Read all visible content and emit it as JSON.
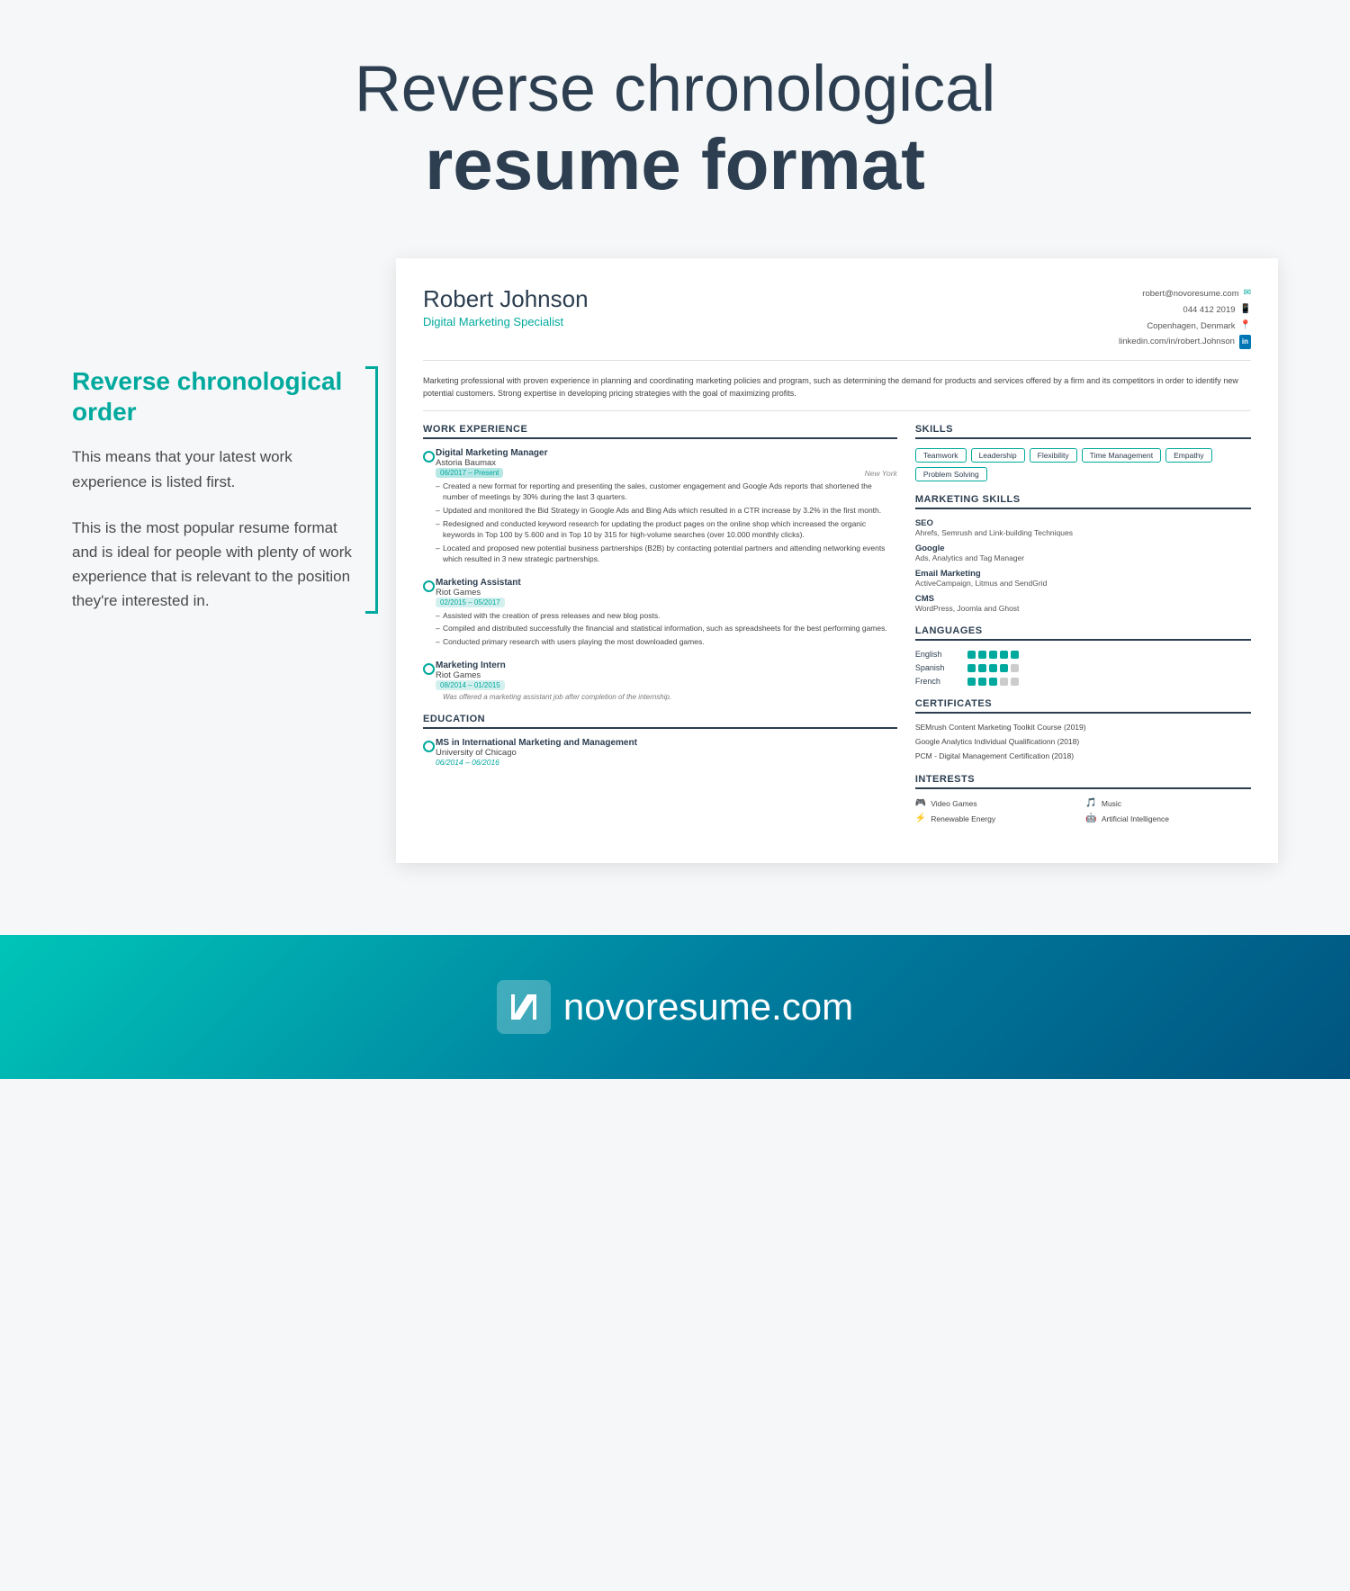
{
  "page": {
    "title_light": "Reverse chronological",
    "title_bold": "resume format",
    "background_color": "#f5f7f8"
  },
  "sidebar": {
    "heading": "Reverse chronological order",
    "para1": "This means that your latest work experience is listed first.",
    "para2": "This is the most popular resume format and is ideal for people with plenty of work experience that is relevant to the position they're interested in."
  },
  "resume": {
    "name": "Robert Johnson",
    "title": "Digital Marketing Specialist",
    "contact": {
      "email": "robert@novoresume.com",
      "phone": "044 412 2019",
      "location": "Copenhagen, Denmark",
      "linkedin": "linkedin.com/in/robert.Johnson"
    },
    "summary": "Marketing professional with proven experience in planning and coordinating marketing policies and program, such as determining the demand for products and services offered by a firm and its competitors in order to identify new potential customers. Strong expertise in developing pricing strategies with the goal of maximizing profits.",
    "sections": {
      "work_experience_header": "WORK EXPERIENCE",
      "skills_header": "SKILLS",
      "marketing_skills_header": "MARKETING SKILLS",
      "languages_header": "LANGUAGES",
      "certificates_header": "CERTIFICATES",
      "interests_header": "INTERESTS",
      "education_header": "EDUCATION"
    },
    "work_experience": [
      {
        "title": "Digital Marketing Manager",
        "company": "Astoria Baumax",
        "dates": "06/2017 – Present",
        "location": "New York",
        "bullets": [
          "Created a new format for reporting and presenting the sales, customer engagement and Google Ads reports that shortened the number of meetings by 30% during the last 3 quarters.",
          "Updated and monitored the Bid Strategy in Google Ads and Bing Ads which resulted in a CTR increase by 3.2% in the first month.",
          "Redesigned and conducted keyword research for updating the product pages on the online shop which increased the organic keywords in Top 100 by 5.600 and in Top 10 by 315 for high-volume searches (over 10.000 monthly clicks).",
          "Located and proposed new potential business partnerships (B2B) by contacting potential partners and attending networking events which resulted in 3 new strategic partnerships."
        ]
      },
      {
        "title": "Marketing Assistant",
        "company": "Riot Games",
        "dates": "02/2015 – 05/2017",
        "location": "",
        "bullets": [
          "Assisted with the creation of press releases and new blog posts.",
          "Compiled and distributed successfully the financial and statistical information, such as spreadsheets for the best performing games.",
          "Conducted primary research with users playing the most downloaded games."
        ]
      },
      {
        "title": "Marketing Intern",
        "company": "Riot Games",
        "dates": "08/2014 – 01/2015",
        "location": "",
        "note": "Was offered a marketing assistant job after completion of the internship.",
        "bullets": []
      }
    ],
    "education": [
      {
        "degree": "MS in International Marketing and Management",
        "school": "University of Chicago",
        "dates": "06/2014 – 06/2016"
      }
    ],
    "skills": {
      "tags": [
        "Teamwork",
        "Leadership",
        "Flexibility",
        "Time Management",
        "Empathy",
        "Problem Solving"
      ]
    },
    "marketing_skills": [
      {
        "name": "SEO",
        "detail": "Ahrefs, Semrush and Link-building Techniques"
      },
      {
        "name": "Google",
        "detail": "Ads, Analytics and Tag Manager"
      },
      {
        "name": "Email Marketing",
        "detail": "ActiveCampaign, Litmus and SendGrid"
      },
      {
        "name": "CMS",
        "detail": "WordPress, Joomla and Ghost"
      }
    ],
    "languages": [
      {
        "name": "English",
        "level": 5
      },
      {
        "name": "Spanish",
        "level": 4
      },
      {
        "name": "French",
        "level": 3
      }
    ],
    "certificates": [
      "SEMrush Content Marketing Toolkit Course (2019)",
      "Google Analytics Individual Qualificationn (2018)",
      "PCM - Digital Management Certification (2018)"
    ],
    "interests": [
      {
        "icon": "🎮",
        "label": "Video Games"
      },
      {
        "icon": "🎵",
        "label": "Music"
      },
      {
        "icon": "⚡",
        "label": "Renewable Energy"
      },
      {
        "icon": "🤖",
        "label": "Artificial Intelligence"
      }
    ]
  },
  "footer": {
    "logo_letter": "N",
    "brand_name": "novoresume",
    "brand_tld": ".com"
  }
}
